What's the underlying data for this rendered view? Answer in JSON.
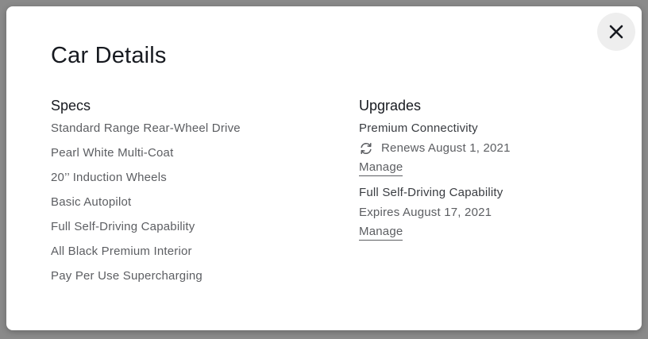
{
  "modal": {
    "title": "Car Details",
    "close_icon": "close-icon"
  },
  "specs": {
    "heading": "Specs",
    "items": [
      "Standard Range Rear-Wheel Drive",
      "Pearl White Multi-Coat",
      "20’’ Induction Wheels",
      "Basic Autopilot",
      "Full Self-Driving Capability",
      "All Black Premium Interior",
      "Pay Per Use Supercharging"
    ]
  },
  "upgrades": {
    "heading": "Upgrades",
    "items": [
      {
        "name": "Premium Connectivity",
        "status": "Renews August 1, 2021",
        "status_icon": "renew-icon",
        "link": "Manage"
      },
      {
        "name": "Full Self-Driving Capability",
        "status": "Expires August 17, 2021",
        "link": "Manage"
      }
    ]
  },
  "colors": {
    "modal_bg": "#ffffff",
    "overlay": "#8a8a8a",
    "heading_text": "#171a20",
    "body_text": "#5c5e62",
    "close_button_bg": "#eeeeee"
  }
}
